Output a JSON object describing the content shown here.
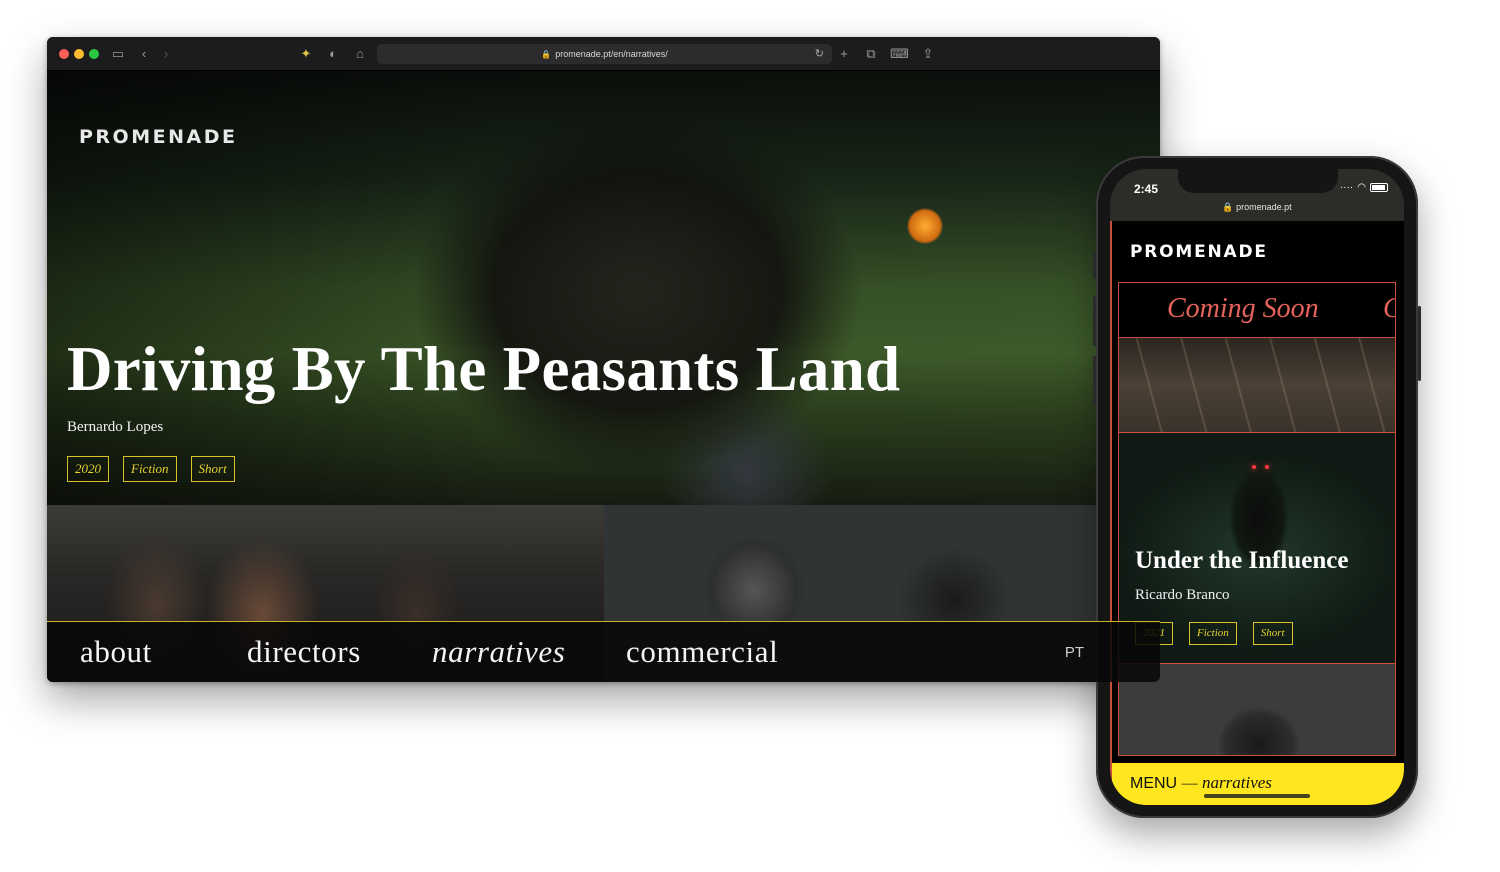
{
  "desktop": {
    "url": "promenade.pt/en/narratives/",
    "brand": "PROMENADE",
    "hero": {
      "title": "Driving By The Peasants Land",
      "director": "Bernardo Lopes",
      "tags": [
        "2020",
        "Fiction",
        "Short"
      ]
    },
    "nav": {
      "items": [
        "about",
        "directors",
        "narratives",
        "commercial"
      ],
      "active": "narratives",
      "language": "PT"
    }
  },
  "phone": {
    "time": "2:45",
    "url": "promenade.pt",
    "brand": "PROMENADE",
    "coming_soon": "Coming Soon",
    "coming_soon_next": "C",
    "card": {
      "title": "Under the Influence",
      "director": "Ricardo Branco",
      "tags": [
        "2021",
        "Fiction",
        "Short"
      ]
    },
    "menu": {
      "label": "MENU",
      "separator": "—",
      "current": "narratives"
    }
  },
  "colors": {
    "tag_border": "#d8c227",
    "phone_accent": "#c94f3c",
    "menu_bar": "#ffe61e"
  }
}
